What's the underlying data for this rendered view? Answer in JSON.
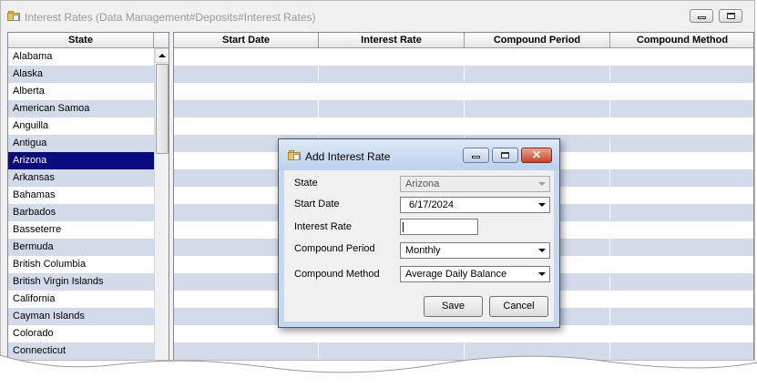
{
  "window": {
    "title": "Interest Rates (Data Management#Deposits#Interest Rates)",
    "title_color": "#9a9a9a"
  },
  "state_list": {
    "header": "State",
    "selected": "Arizona",
    "selection_color": "#0a0a80",
    "alt_row_color": "#d3dbea",
    "items": [
      "Alabama",
      "Alaska",
      "Alberta",
      "American Samoa",
      "Anguilla",
      "Antigua",
      "Arizona",
      "Arkansas",
      "Bahamas",
      "Barbados",
      "Basseterre",
      "Bermuda",
      "British Columbia",
      "British Virgin Islands",
      "California",
      "Cayman Islands",
      "Colorado",
      "Connecticut"
    ]
  },
  "grid": {
    "columns": [
      "Start Date",
      "Interest Rate",
      "Compound Period",
      "Compound Method"
    ],
    "rows": []
  },
  "dialog": {
    "title": "Add Interest Rate",
    "fields": {
      "state": {
        "label": "State",
        "value": "Arizona",
        "disabled": true
      },
      "start_date": {
        "label": "Start Date",
        "value": "6/17/2024"
      },
      "interest_rate": {
        "label": "Interest Rate",
        "value": ""
      },
      "compound_period": {
        "label": "Compound Period",
        "value": "Monthly"
      },
      "compound_method": {
        "label": "Compound Method",
        "value": "Average Daily Balance"
      }
    },
    "buttons": {
      "save": "Save",
      "cancel": "Cancel"
    },
    "close_color": "#c8452a"
  }
}
